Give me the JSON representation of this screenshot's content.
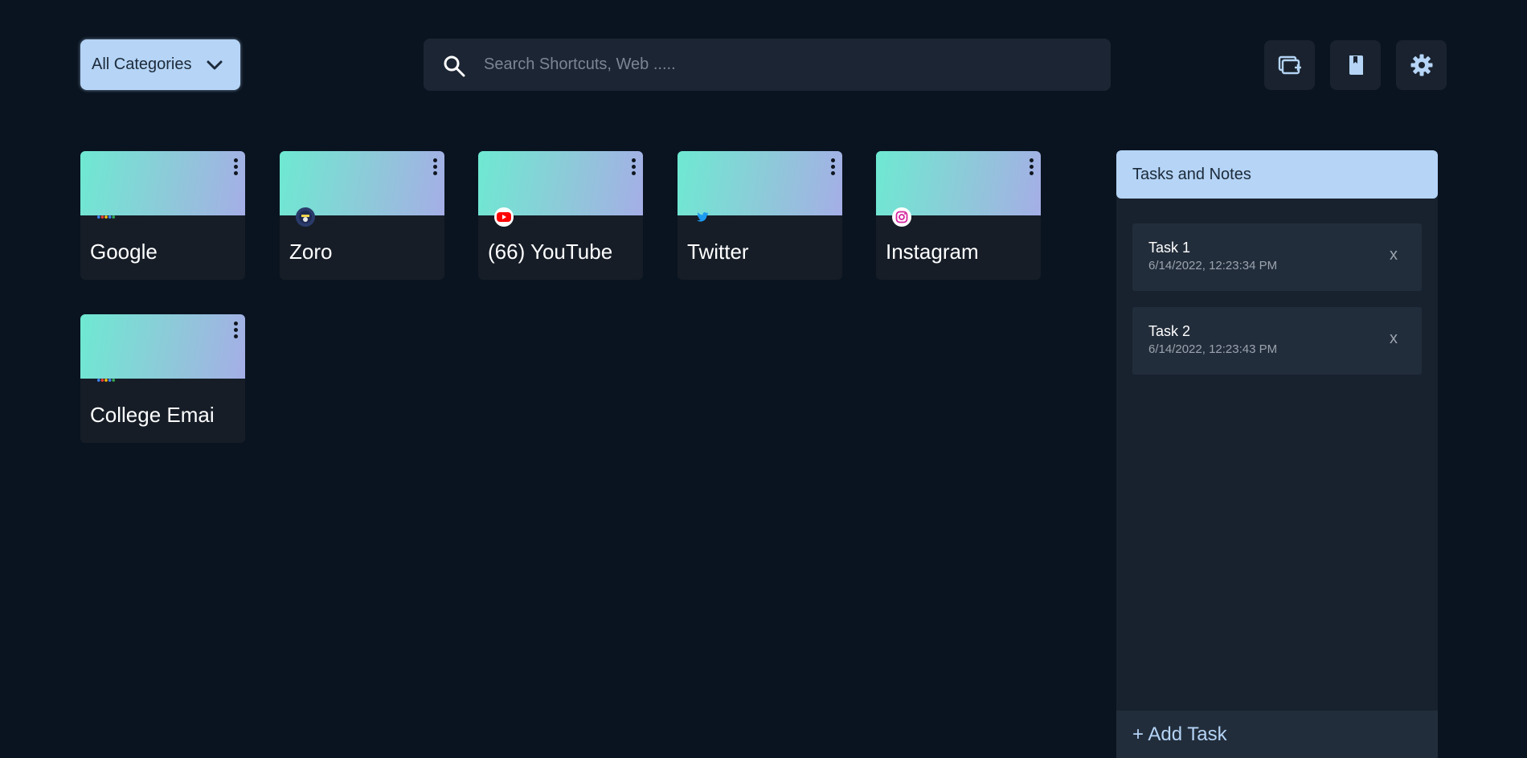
{
  "header": {
    "category_label": "All Categories",
    "search_placeholder": "Search Shortcuts, Web .....",
    "buttons": [
      "add-window-icon",
      "bookmark-icon",
      "gear-icon"
    ]
  },
  "shortcuts": [
    {
      "title": "Google",
      "favicon": "google-logo-icon"
    },
    {
      "title": "Zoro",
      "favicon": "zoro-logo-icon"
    },
    {
      "title": "(66) YouTube",
      "favicon": "youtube-logo-icon"
    },
    {
      "title": "Twitter",
      "favicon": "twitter-logo-icon"
    },
    {
      "title": "Instagram",
      "favicon": "instagram-logo-icon"
    },
    {
      "title": "College Emai",
      "favicon": "google-logo-icon"
    }
  ],
  "tasks_panel": {
    "title": "Tasks and Notes",
    "tasks": [
      {
        "title": "Task 1",
        "time": "6/14/2022, 12:23:34 PM",
        "close": "x"
      },
      {
        "title": "Task 2",
        "time": "6/14/2022, 12:23:43 PM",
        "close": "x"
      }
    ],
    "add_label": "+ Add Task"
  },
  "colors": {
    "background": "#0a1420",
    "accent": "#b5d4f6",
    "tile_gradient_start": "#6ee9d2",
    "tile_gradient_end": "#a5aee6"
  }
}
